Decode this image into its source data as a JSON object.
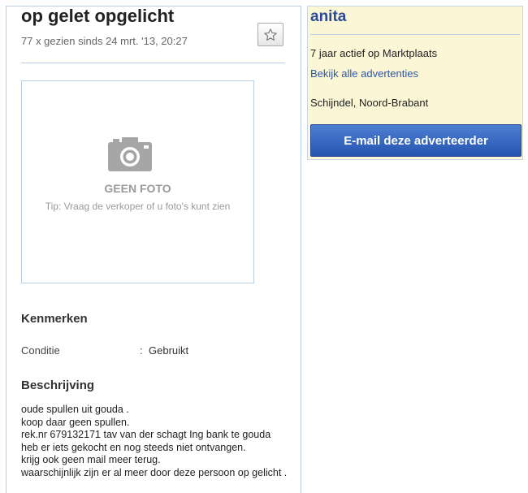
{
  "listing": {
    "title": "op gelet opgelicht",
    "stats": "77 x gezien sinds 24 mrt. '13, 20:27"
  },
  "photo": {
    "no_photo_label": "GEEN FOTO",
    "tip": "Tip: Vraag de verkoper of u foto's kunt zien"
  },
  "attributes": {
    "heading": "Kenmerken",
    "items": [
      {
        "label": "Conditie",
        "separator": ":",
        "value": "Gebruikt"
      }
    ]
  },
  "description": {
    "heading": "Beschrijving",
    "lines": [
      "oude spullen uit gouda .",
      "koop daar geen spullen.",
      "rek.nr 679132171 tav  van der schagt Ing bank te gouda",
      "heb er iets gekocht en nog steeds niet ontvangen.",
      "krijg ook geen mail meer terug.",
      "waarschijnlijk zijn er al meer door deze persoon op gelicht ."
    ]
  },
  "seller": {
    "name": "anita",
    "active": "7 jaar actief op Marktplaats",
    "all_ads_link": "Bekijk alle advertenties",
    "location": "Schijndel, Noord-Brabant",
    "email_button": "E-mail deze adverteerder"
  },
  "icons": {
    "favorite": "star-outline-icon",
    "camera": "camera-icon"
  },
  "colors": {
    "accent_blue": "#2a57a6",
    "button_blue": "#2554b0",
    "seller_card_bg": "#fbf6d6",
    "border_blue": "#b9cde2"
  }
}
